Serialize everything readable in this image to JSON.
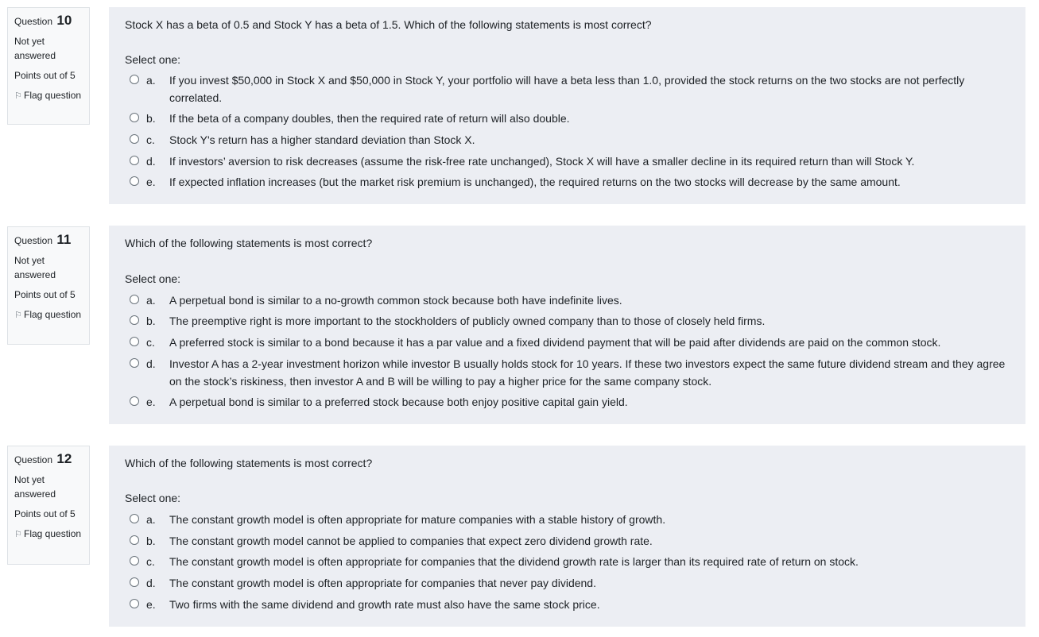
{
  "questions": [
    {
      "label": "Question",
      "number": "10",
      "state": "Not yet answered",
      "grade": "Points out of 5",
      "flag": "Flag question",
      "text": "Stock X has a beta of 0.5 and Stock Y has a beta of 1.5. Which of the following statements is most correct?",
      "prompt": "Select one:",
      "answers": [
        {
          "letter": "a.",
          "text": "If you invest $50,000 in Stock X and $50,000 in Stock Y, your portfolio will have a beta less than 1.0, provided the stock returns on the two stocks are not perfectly correlated."
        },
        {
          "letter": "b.",
          "text": "If the beta of a company doubles, then the required rate of return will also double."
        },
        {
          "letter": "c.",
          "text": "Stock Y's return has a higher standard deviation than Stock X."
        },
        {
          "letter": "d.",
          "text": "If investors’ aversion to risk decreases (assume the risk-free rate unchanged), Stock X will have a smaller decline in its required return than will Stock Y."
        },
        {
          "letter": "e.",
          "text": "If expected inflation increases (but the market risk premium is unchanged), the required returns on the two stocks will decrease by the same amount."
        }
      ]
    },
    {
      "label": "Question",
      "number": "11",
      "state": "Not yet answered",
      "grade": "Points out of 5",
      "flag": "Flag question",
      "text": "Which of the following statements is most correct?",
      "prompt": "Select one:",
      "answers": [
        {
          "letter": "a.",
          "text": "A perpetual bond is similar to a no-growth common stock because both have indefinite lives."
        },
        {
          "letter": "b.",
          "text": "The preemptive right is more important to the stockholders of publicly owned company than to those of closely held firms."
        },
        {
          "letter": "c.",
          "text": "A preferred stock is similar to a bond because it has a par value and a fixed dividend payment that will be paid after dividends are paid on the common stock."
        },
        {
          "letter": "d.",
          "text": "Investor A has a 2-year investment horizon while investor B usually holds stock for 10 years. If these two investors expect the same future dividend stream and they agree on the stock’s riskiness, then investor A and B will be willing to pay a higher price for the same company stock."
        },
        {
          "letter": "e.",
          "text": "A perpetual bond is similar to a preferred stock because both enjoy positive capital gain yield."
        }
      ]
    },
    {
      "label": "Question",
      "number": "12",
      "state": "Not yet answered",
      "grade": "Points out of 5",
      "flag": "Flag question",
      "text": "Which of the following statements is most correct?",
      "prompt": "Select one:",
      "answers": [
        {
          "letter": "a.",
          "text": "The constant growth model is often appropriate for mature companies with a stable history of growth."
        },
        {
          "letter": "b.",
          "text": "The constant growth model cannot be applied to companies that expect zero dividend growth rate."
        },
        {
          "letter": "c.",
          "text": "The constant growth model is often appropriate for companies that the dividend growth rate is larger than its required rate of return on stock."
        },
        {
          "letter": "d.",
          "text": "The constant growth model is often appropriate for companies that never pay dividend."
        },
        {
          "letter": "e.",
          "text": "Two firms with the same dividend and growth rate must also have the same stock price."
        }
      ]
    }
  ]
}
